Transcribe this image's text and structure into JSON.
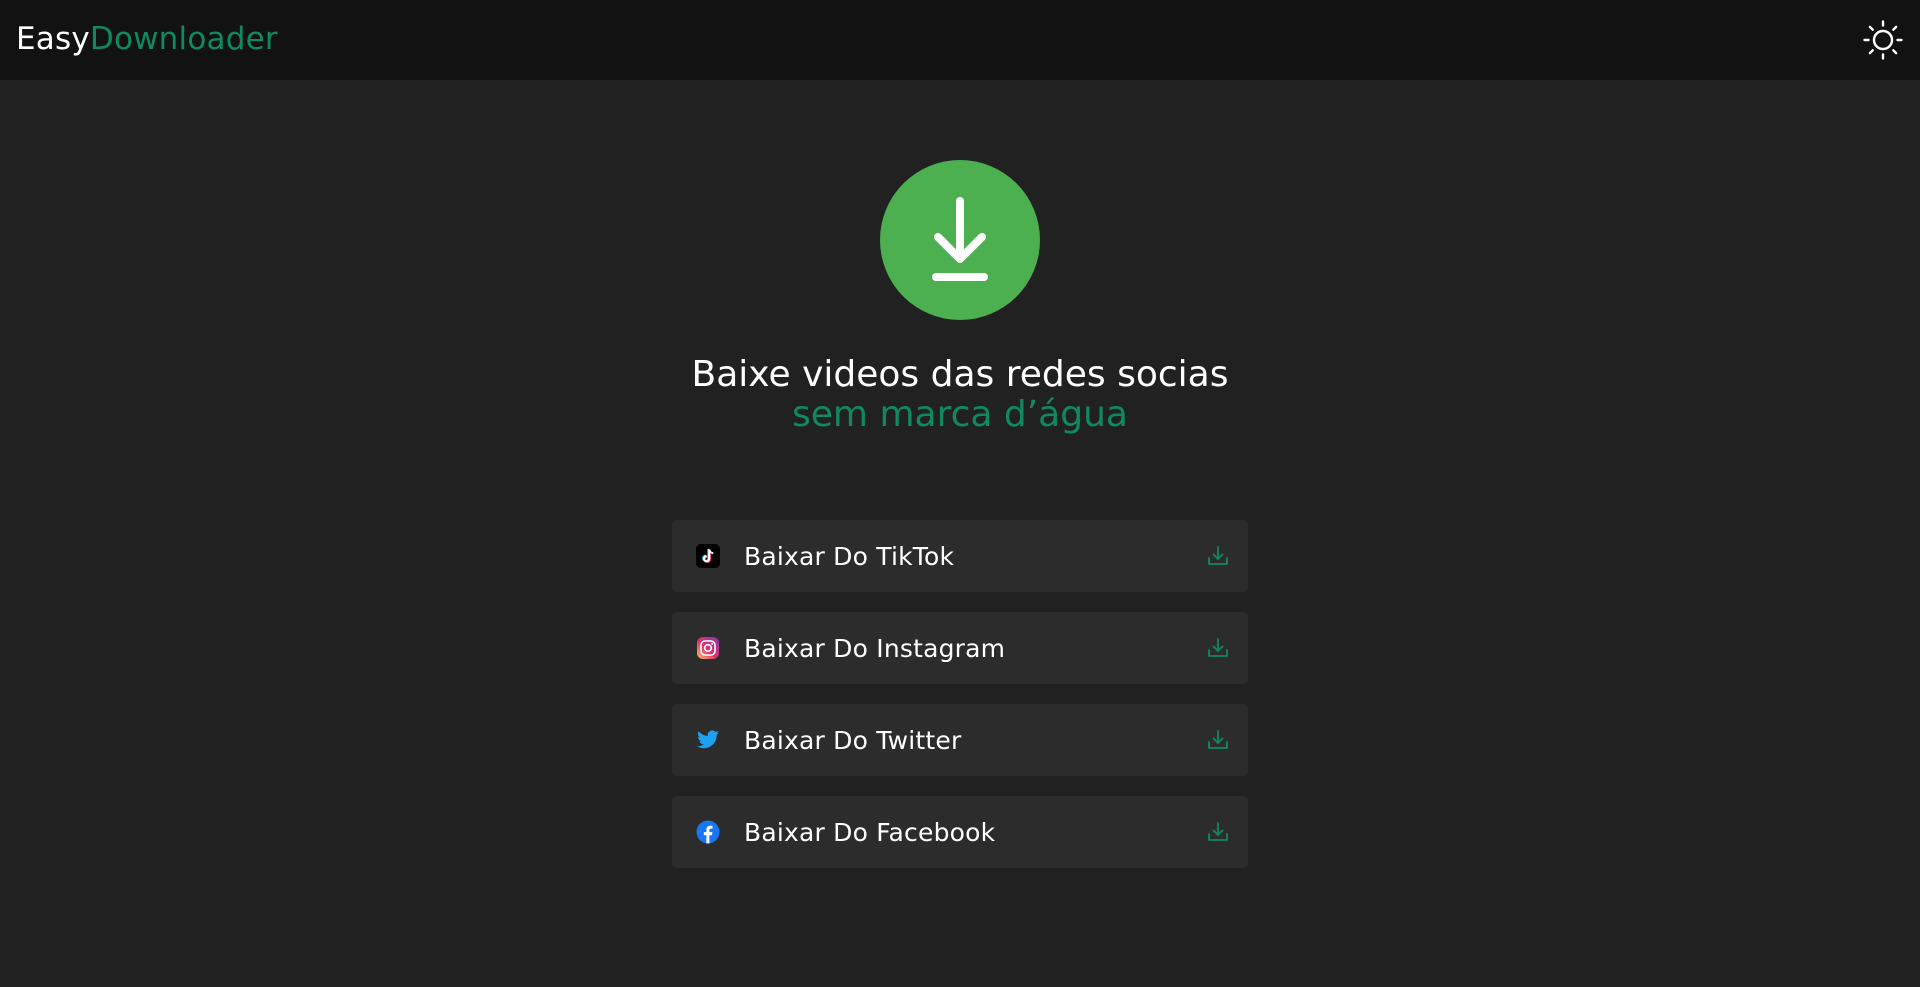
{
  "header": {
    "logo_part1": "Easy",
    "logo_part2": "Downloader",
    "theme_icon": "sun-icon"
  },
  "hero": {
    "icon": "download-icon",
    "title_line1": "Baixe videos das redes socias",
    "title_line2": "sem marca d’água"
  },
  "options": [
    {
      "label": "Baixar Do TikTok",
      "icon": "tiktok-icon"
    },
    {
      "label": "Baixar Do Instagram",
      "icon": "instagram-icon"
    },
    {
      "label": "Baixar Do Twitter",
      "icon": "twitter-icon"
    },
    {
      "label": "Baixar Do Facebook",
      "icon": "facebook-icon"
    }
  ],
  "colors": {
    "background": "#212121",
    "header": "#121212",
    "accent": "#0f8a5f",
    "hero_circle": "#4caf50",
    "card": "#2c2c2c"
  }
}
